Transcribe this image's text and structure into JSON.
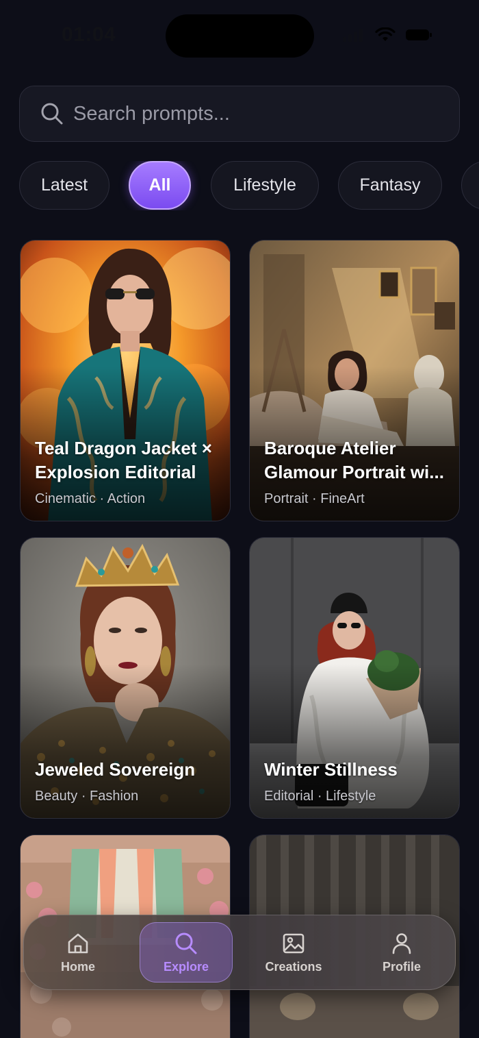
{
  "status_bar": {
    "time": "01:04"
  },
  "search": {
    "placeholder": "Search prompts..."
  },
  "filters": [
    {
      "label": "Latest",
      "active": false
    },
    {
      "label": "All",
      "active": true
    },
    {
      "label": "Lifestyle",
      "active": false
    },
    {
      "label": "Fantasy",
      "active": false
    }
  ],
  "cards": [
    {
      "title": "Teal Dragon Jacket ×\nExplosion Editorial",
      "tags": "Cinematic · Action"
    },
    {
      "title": "Baroque Atelier\nGlamour Portrait wi...",
      "tags": "Portrait · FineArt"
    },
    {
      "title": "Jeweled Sovereign",
      "tags": "Beauty · Fashion"
    },
    {
      "title": "Winter Stillness",
      "tags": "Editorial · Lifestyle"
    }
  ],
  "bottom_nav": [
    {
      "label": "Home",
      "icon": "home-icon",
      "active": false
    },
    {
      "label": "Explore",
      "icon": "search-icon",
      "active": true
    },
    {
      "label": "Creations",
      "icon": "image-icon",
      "active": false
    },
    {
      "label": "Profile",
      "icon": "person-icon",
      "active": false
    }
  ],
  "colors": {
    "background": "#0d0e18",
    "accent": "#8b5cf6",
    "accent_label": "#b78cff",
    "chip_border": "#2b2c3a"
  }
}
